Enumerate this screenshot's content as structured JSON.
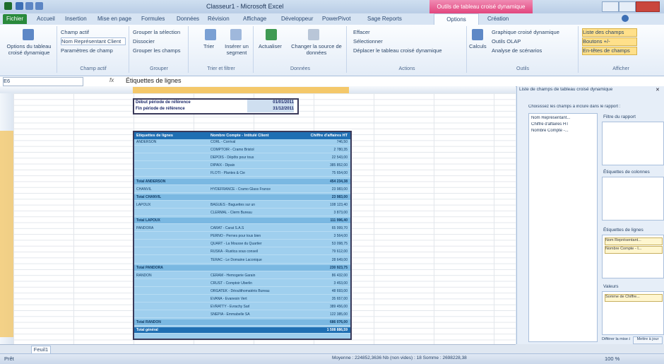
{
  "window": {
    "title": "Classeur1 - Microsoft Excel",
    "context_tab": "Outils de tableau croisé dynamique"
  },
  "ribbon_tabs": [
    "Fichier",
    "Accueil",
    "Insertion",
    "Mise en page",
    "Formules",
    "Données",
    "Révision",
    "Affichage",
    "Développeur",
    "PowerPivot",
    "Sage Reports",
    "Options",
    "Création"
  ],
  "ribbon": {
    "pivot_name_label": "Options du tableau croisé dynamique",
    "active_field": "Champ actif",
    "active_field_value": "Nom Représentant Client",
    "field_settings": "Paramètres de champ",
    "group_selection": "Grouper la sélection",
    "ungroup": "Dissocier",
    "group_field": "Grouper les champs",
    "sort": "Trier",
    "insert_slicer": "Insérer un segment",
    "refresh": "Actualiser",
    "change_source": "Changer la source de données",
    "clear": "Effacer",
    "select": "Sélectionner",
    "move_pivot": "Déplacer le tableau croisé dynamique",
    "calculations": "Calculs",
    "pivot_chart": "Graphique croisé dynamique",
    "olap_tools": "Outils OLAP",
    "what_if": "Analyse de scénarios",
    "show_field_list": "Liste des champs",
    "show_buttons": "Boutons +/-",
    "show_headers": "En-têtes de champs",
    "group_labels": [
      "Champ actif",
      "Grouper",
      "Trier et filtrer",
      "Données",
      "Actions",
      "Outils",
      "Afficher"
    ]
  },
  "formula_bar": {
    "name_box": "E6",
    "formula": "Étiquettes de lignes"
  },
  "date_box": {
    "start_label": "Début période de référence",
    "start_value": "01/01/2011",
    "end_label": "Fin période de référence",
    "end_value": "31/12/2011"
  },
  "pivot": {
    "headers": [
      "Étiquettes de lignes",
      "Nombre Compte - Intitulé Client",
      "Chiffre d'affaires HT"
    ],
    "rows": [
      {
        "c1": "ANDERSON",
        "c2": "CORL - Corrival",
        "c3": "746,50",
        "type": "row"
      },
      {
        "c1": "",
        "c2": "COMPTOIR - Cramo Bristol",
        "c3": "2 780,35",
        "type": "row"
      },
      {
        "c1": "",
        "c2": "DEPOIS - Dépôts pour tous",
        "c3": "22 543,00",
        "type": "row"
      },
      {
        "c1": "",
        "c2": "DIPAIX - Dipaix",
        "c3": "385 852,00",
        "type": "row"
      },
      {
        "c1": "",
        "c2": "FLOTI - Plantes & Cie",
        "c3": "75 654,00",
        "type": "row"
      },
      {
        "c1": "Total ANDERSON",
        "c2": "",
        "c3": "454 234,38",
        "type": "total"
      },
      {
        "c1": "CHANVIL",
        "c2": "HYDEFRANCE - Cramo Glass France",
        "c3": "23 983,00",
        "type": "row"
      },
      {
        "c1": "Total CHANVIL",
        "c2": "",
        "c3": "23 983,00",
        "type": "total"
      },
      {
        "c1": "LAPOUX",
        "c2": "BAGUES - Baguettes sur un",
        "c3": "108 123,40",
        "type": "row"
      },
      {
        "c1": "",
        "c2": "CLERMAL - Clerm Bureau",
        "c3": "3 873,00",
        "type": "row"
      },
      {
        "c1": "Total LAPOUX",
        "c2": "",
        "c3": "111 996,40",
        "type": "total"
      },
      {
        "c1": "PANDORA",
        "c2": "CARAT - Carat S.A.S",
        "c3": "65 999,70",
        "type": "row"
      },
      {
        "c1": "",
        "c2": "PERNO - Pernes pour tous bien",
        "c3": "3 564,00",
        "type": "row"
      },
      {
        "c1": "",
        "c2": "QUART - La Mousse du Quartier",
        "c3": "53 098,75",
        "type": "row"
      },
      {
        "c1": "",
        "c2": "RUSKA - Rustica sous conseil",
        "c3": "79 612,00",
        "type": "row"
      },
      {
        "c1": "",
        "c2": "TERAC - Le Domaine Laconique",
        "c3": "28 649,00",
        "type": "row"
      },
      {
        "c1": "Total PANDORA",
        "c2": "",
        "c3": "230 923,75",
        "type": "total"
      },
      {
        "c1": "RANDON",
        "c2": "CERAM - Hemogerie Garain",
        "c3": "86 432,00",
        "type": "row"
      },
      {
        "c1": "",
        "c2": "CRUST - Comptoir Uberlin",
        "c3": "3 453,00",
        "type": "row"
      },
      {
        "c1": "",
        "c2": "ORGATEK - Déoulithomatéris Bureau",
        "c3": "48 693,00",
        "type": "row"
      },
      {
        "c1": "",
        "c2": "EVANA - Evanesin Vert",
        "c3": "35 657,00",
        "type": "row"
      },
      {
        "c1": "",
        "c2": "EVRATTY - Evrachy Sarl",
        "c3": "389 456,00",
        "type": "row"
      },
      {
        "c1": "",
        "c2": "SNEPIA - Emmabelle SA",
        "c3": "122 385,00",
        "type": "row"
      },
      {
        "c1": "Total RANDON",
        "c2": "",
        "c3": "686 076,00",
        "type": "total"
      },
      {
        "c1": "Total général",
        "c2": "",
        "c3": "1 508 886,59",
        "type": "grand"
      }
    ]
  },
  "field_list": {
    "title": "Liste de champs de tableau croisé dynamique",
    "subtitle": "Choisissez les champs à inclure dans le rapport :",
    "fields": [
      "Nom Représentant...",
      "Chiffre d'affaires HT",
      "Nombre Compte -..."
    ],
    "zone_filter": "Filtre du rapport",
    "zone_columns": "Étiquettes de colonnes",
    "zone_rows": "Étiquettes de lignes",
    "zone_values": "Valeurs",
    "row_items": [
      "Nom Représentant...",
      "Nombre Compte - I..."
    ],
    "value_items": [
      "Somme de Chiffre..."
    ],
    "defer_label": "Différer la mise à jour de la disposition",
    "update_btn": "Mettre à jour"
  },
  "sheet_tabs": [
    "Feuil1"
  ],
  "status": {
    "mode": "Prêt",
    "summary": "Moyenne : 224852,3636   Nb (non vides) : 18   Somme : 2698228,38",
    "zoom": "100 %"
  }
}
